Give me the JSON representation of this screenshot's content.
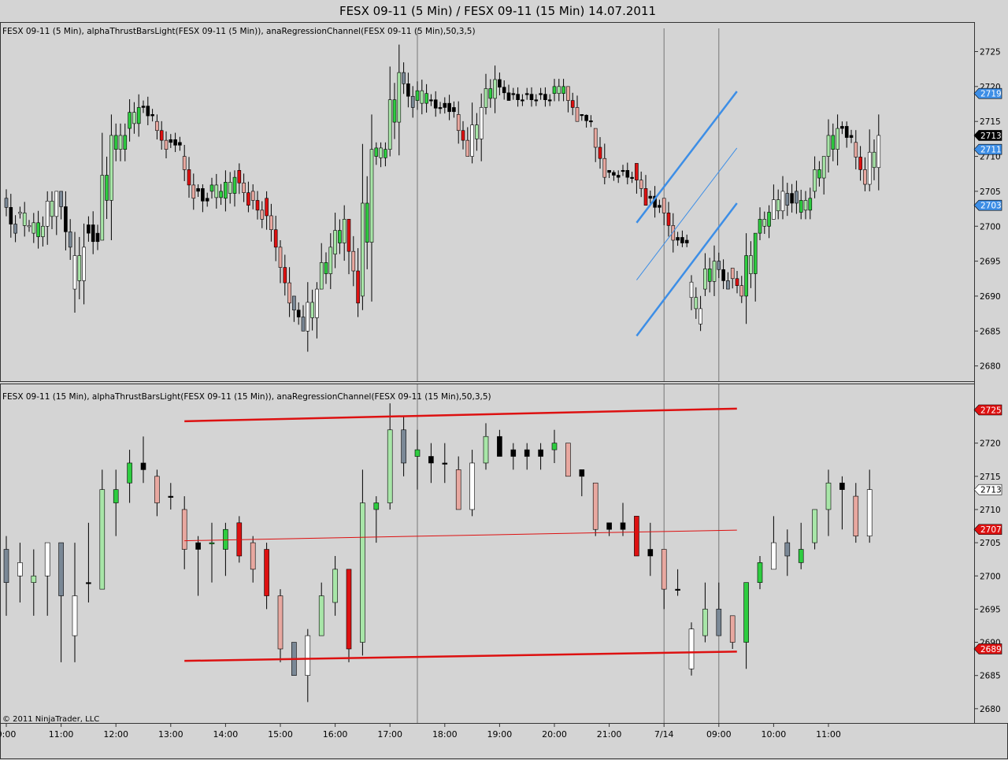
{
  "window": {
    "title": "FESX 09-11 (5 Min) / FESX 09-11 (15 Min)  14.07.2011",
    "copyright": "© 2011 NinjaTrader, LLC"
  },
  "colors": {
    "background": "#d4d4d4",
    "bull_strong": "#2ecc40",
    "bull_light": "#a8e6a8",
    "bear_strong": "#dd1111",
    "bear_light": "#e8a8a0",
    "neutral_up": "#ffffff",
    "neutral_down": "#000000",
    "gray_bar": "#7a8896",
    "channel_top": "#3d8ee6",
    "channel_bottom": "#dd1111"
  },
  "x_axis": {
    "tick_labels": [
      "0:00",
      "11:00",
      "12:00",
      "13:00",
      "14:00",
      "15:00",
      "16:00",
      "17:00",
      "18:00",
      "19:00",
      "20:00",
      "21:00",
      "7/14",
      "09:00",
      "10:00",
      "11:00"
    ],
    "session_markers": [
      "17:30",
      "7/14",
      "09:00"
    ]
  },
  "chart_data": [
    {
      "type": "candlestick",
      "title": "FESX 09-11  (5 Min), alphaThrustBarsLight(FESX 09-11  (5 Min)), anaRegressionChannel(FESX 09-11  (5 Min),50,3,5)",
      "ylim": [
        2678,
        2728
      ],
      "yticks": [
        2680,
        2685,
        2690,
        2695,
        2700,
        2705,
        2710,
        2715,
        2720,
        2725
      ],
      "regression_channel": {
        "upper": [
          [
            21.5,
            2700.5
          ],
          [
            23.33,
            2719.3
          ]
        ],
        "middle": [
          [
            21.5,
            2692.3
          ],
          [
            23.33,
            2711.2
          ]
        ],
        "lower": [
          [
            21.5,
            2684.3
          ],
          [
            23.33,
            2703.3
          ]
        ]
      },
      "price_labels": [
        {
          "value": 2719,
          "text": "2719",
          "bg": "#3d8ee6",
          "fg": "#ffffff"
        },
        {
          "value": 2713,
          "text": "2713",
          "bg": "#000000",
          "fg": "#ffffff"
        },
        {
          "value": 2711,
          "text": "2711",
          "bg": "#3d8ee6",
          "fg": "#ffffff"
        },
        {
          "value": 2703,
          "text": "2703",
          "bg": "#3d8ee6",
          "fg": "#ffffff"
        }
      ]
    },
    {
      "type": "candlestick",
      "title": "FESX 09-11  (15 Min), alphaThrustBarsLight(FESX 09-11  (15 Min)), anaRegressionChannel(FESX 09-11  (15 Min),50,3,5)",
      "ylim": [
        2678,
        2728
      ],
      "yticks": [
        2680,
        2685,
        2690,
        2695,
        2700,
        2705,
        2710,
        2715,
        2720,
        2725
      ],
      "regression_channel": {
        "upper": [
          [
            13.25,
            2723.3
          ],
          [
            23.33,
            2725.2
          ]
        ],
        "middle": [
          [
            13.25,
            2705.3
          ],
          [
            23.33,
            2706.9
          ]
        ],
        "lower": [
          [
            13.25,
            2687.2
          ],
          [
            23.33,
            2688.6
          ]
        ]
      },
      "price_labels": [
        {
          "value": 2725,
          "text": "2725",
          "bg": "#dd1111",
          "fg": "#ffffff"
        },
        {
          "value": 2713,
          "text": "2713",
          "bg": "#ffffff",
          "fg": "#000000"
        },
        {
          "value": 2707,
          "text": "2707",
          "bg": "#dd1111",
          "fg": "#ffffff"
        },
        {
          "value": 2689,
          "text": "2689",
          "bg": "#dd1111",
          "fg": "#ffffff"
        }
      ],
      "candles": [
        {
          "t": 10.0,
          "o": 2704,
          "h": 2706,
          "l": 2694,
          "c": 2699,
          "k": "gray"
        },
        {
          "t": 10.25,
          "o": 2702,
          "h": 2705,
          "l": 2696,
          "c": 2700,
          "k": "white"
        },
        {
          "t": 10.5,
          "o": 2699,
          "h": 2704,
          "l": 2694,
          "c": 2700,
          "k": "lgreen"
        },
        {
          "t": 10.75,
          "o": 2700,
          "h": 2705,
          "l": 2694,
          "c": 2705,
          "k": "white"
        },
        {
          "t": 11.0,
          "o": 2705,
          "h": 2705,
          "l": 2687,
          "c": 2697,
          "k": "gray"
        },
        {
          "t": 11.25,
          "o": 2691,
          "h": 2705,
          "l": 2687,
          "c": 2697,
          "k": "white"
        },
        {
          "t": 11.5,
          "o": 2699,
          "h": 2708,
          "l": 2696,
          "c": 2699,
          "k": "black"
        },
        {
          "t": 11.75,
          "o": 2698,
          "h": 2716,
          "l": 2698,
          "c": 2713,
          "k": "lgreen"
        },
        {
          "t": 12.0,
          "o": 2711,
          "h": 2716,
          "l": 2706,
          "c": 2713,
          "k": "green"
        },
        {
          "t": 12.25,
          "o": 2714,
          "h": 2719,
          "l": 2711,
          "c": 2717,
          "k": "green"
        },
        {
          "t": 12.5,
          "o": 2717,
          "h": 2721,
          "l": 2714,
          "c": 2716,
          "k": "black"
        },
        {
          "t": 12.75,
          "o": 2715,
          "h": 2716,
          "l": 2709,
          "c": 2711,
          "k": "lred"
        },
        {
          "t": 13.0,
          "o": 2712,
          "h": 2714,
          "l": 2710,
          "c": 2712,
          "k": "black"
        },
        {
          "t": 13.25,
          "o": 2710,
          "h": 2712,
          "l": 2701,
          "c": 2704,
          "k": "lred"
        },
        {
          "t": 13.5,
          "o": 2705,
          "h": 2706,
          "l": 2697,
          "c": 2704,
          "k": "black"
        },
        {
          "t": 13.75,
          "o": 2705,
          "h": 2708,
          "l": 2699,
          "c": 2705,
          "k": "green"
        },
        {
          "t": 14.0,
          "o": 2704,
          "h": 2708,
          "l": 2700,
          "c": 2707,
          "k": "green"
        },
        {
          "t": 14.25,
          "o": 2708,
          "h": 2709,
          "l": 2702,
          "c": 2703,
          "k": "red"
        },
        {
          "t": 14.5,
          "o": 2705,
          "h": 2706,
          "l": 2699,
          "c": 2701,
          "k": "lred"
        },
        {
          "t": 14.75,
          "o": 2704,
          "h": 2705,
          "l": 2695,
          "c": 2697,
          "k": "red"
        },
        {
          "t": 15.0,
          "o": 2697,
          "h": 2698,
          "l": 2687,
          "c": 2689,
          "k": "lred"
        },
        {
          "t": 15.25,
          "o": 2690,
          "h": 2690,
          "l": 2685,
          "c": 2685,
          "k": "gray"
        },
        {
          "t": 15.5,
          "o": 2685,
          "h": 2692,
          "l": 2681,
          "c": 2691,
          "k": "white"
        },
        {
          "t": 15.75,
          "o": 2691,
          "h": 2699,
          "l": 2691,
          "c": 2697,
          "k": "lgreen"
        },
        {
          "t": 16.0,
          "o": 2696,
          "h": 2703,
          "l": 2694,
          "c": 2701,
          "k": "lgreen"
        },
        {
          "t": 16.25,
          "o": 2701,
          "h": 2701,
          "l": 2687,
          "c": 2689,
          "k": "red"
        },
        {
          "t": 16.5,
          "o": 2690,
          "h": 2716,
          "l": 2688,
          "c": 2711,
          "k": "lgreen"
        },
        {
          "t": 16.75,
          "o": 2710,
          "h": 2712,
          "l": 2705,
          "c": 2711,
          "k": "green"
        },
        {
          "t": 17.0,
          "o": 2711,
          "h": 2726,
          "l": 2710,
          "c": 2722,
          "k": "lgreen"
        },
        {
          "t": 17.25,
          "o": 2722,
          "h": 2724,
          "l": 2715,
          "c": 2717,
          "k": "gray"
        },
        {
          "t": 17.5,
          "o": 2718,
          "h": 2722,
          "l": 2713,
          "c": 2719,
          "k": "green"
        },
        {
          "t": 17.75,
          "o": 2718,
          "h": 2720,
          "l": 2714,
          "c": 2717,
          "k": "black"
        },
        {
          "t": 18.0,
          "o": 2717,
          "h": 2720,
          "l": 2714,
          "c": 2717,
          "k": "black"
        },
        {
          "t": 18.25,
          "o": 2716,
          "h": 2718,
          "l": 2711,
          "c": 2710,
          "k": "lred"
        },
        {
          "t": 18.5,
          "o": 2710,
          "h": 2719,
          "l": 2709,
          "c": 2717,
          "k": "white"
        },
        {
          "t": 18.75,
          "o": 2717,
          "h": 2723,
          "l": 2716,
          "c": 2721,
          "k": "lgreen"
        },
        {
          "t": 19.0,
          "o": 2721,
          "h": 2722,
          "l": 2718,
          "c": 2718,
          "k": "black"
        },
        {
          "t": 19.25,
          "o": 2719,
          "h": 2720,
          "l": 2716,
          "c": 2718,
          "k": "black"
        },
        {
          "t": 19.5,
          "o": 2719,
          "h": 2720,
          "l": 2716,
          "c": 2718,
          "k": "black"
        },
        {
          "t": 19.75,
          "o": 2719,
          "h": 2720,
          "l": 2716,
          "c": 2718,
          "k": "black"
        },
        {
          "t": 20.0,
          "o": 2719,
          "h": 2722,
          "l": 2717,
          "c": 2720,
          "k": "green"
        },
        {
          "t": 20.25,
          "o": 2720,
          "h": 2720,
          "l": 2715,
          "c": 2715,
          "k": "lred"
        },
        {
          "t": 20.5,
          "o": 2716,
          "h": 2716,
          "l": 2712,
          "c": 2715,
          "k": "black"
        },
        {
          "t": 20.75,
          "o": 2714,
          "h": 2714,
          "l": 2706,
          "c": 2707,
          "k": "lred"
        },
        {
          "t": 21.0,
          "o": 2708,
          "h": 2708,
          "l": 2706,
          "c": 2707,
          "k": "black"
        },
        {
          "t": 21.25,
          "o": 2708,
          "h": 2711,
          "l": 2706,
          "c": 2707,
          "k": "black"
        },
        {
          "t": 21.5,
          "o": 2709,
          "h": 2709,
          "l": 2703,
          "c": 2703,
          "k": "red"
        },
        {
          "t": 21.75,
          "o": 2704,
          "h": 2708,
          "l": 2700,
          "c": 2703,
          "k": "black"
        },
        {
          "t": 22.0,
          "o": 2704,
          "h": 2704,
          "l": 2695,
          "c": 2698,
          "k": "lred"
        },
        {
          "t": 22.25,
          "o": 2698,
          "h": 2701,
          "l": 2697,
          "c": 2698,
          "k": "black"
        },
        {
          "t": 22.5,
          "o": 2692,
          "h": 2693,
          "l": 2685,
          "c": 2686,
          "k": "white"
        },
        {
          "t": 22.75,
          "o": 2691,
          "h": 2699,
          "l": 2690,
          "c": 2695,
          "k": "lgreen"
        },
        {
          "t": 23.0,
          "o": 2695,
          "h": 2699,
          "l": 2691,
          "c": 2691,
          "k": "gray"
        },
        {
          "t": 23.25,
          "o": 2694,
          "h": 2694,
          "l": 2689,
          "c": 2690,
          "k": "lred"
        },
        {
          "t": 23.5,
          "o": 2690,
          "h": 2699,
          "l": 2686,
          "c": 2699,
          "k": "green"
        },
        {
          "t": 23.75,
          "o": 2699,
          "h": 2703,
          "l": 2698,
          "c": 2702,
          "k": "green"
        },
        {
          "t": 24.0,
          "o": 2701,
          "h": 2709,
          "l": 2701,
          "c": 2705,
          "k": "white"
        },
        {
          "t": 24.25,
          "o": 2703,
          "h": 2707,
          "l": 2700,
          "c": 2705,
          "k": "gray"
        },
        {
          "t": 24.5,
          "o": 2702,
          "h": 2708,
          "l": 2701,
          "c": 2704,
          "k": "green"
        },
        {
          "t": 24.75,
          "o": 2705,
          "h": 2710,
          "l": 2704,
          "c": 2710,
          "k": "lgreen"
        },
        {
          "t": 25.0,
          "o": 2710,
          "h": 2716,
          "l": 2706,
          "c": 2714,
          "k": "lgreen"
        },
        {
          "t": 25.25,
          "o": 2714,
          "h": 2715,
          "l": 2707,
          "c": 2713,
          "k": "black"
        },
        {
          "t": 25.5,
          "o": 2712,
          "h": 2714,
          "l": 2705,
          "c": 2706,
          "k": "lred"
        },
        {
          "t": 25.75,
          "o": 2706,
          "h": 2716,
          "l": 2705,
          "c": 2713,
          "k": "white"
        }
      ]
    }
  ]
}
